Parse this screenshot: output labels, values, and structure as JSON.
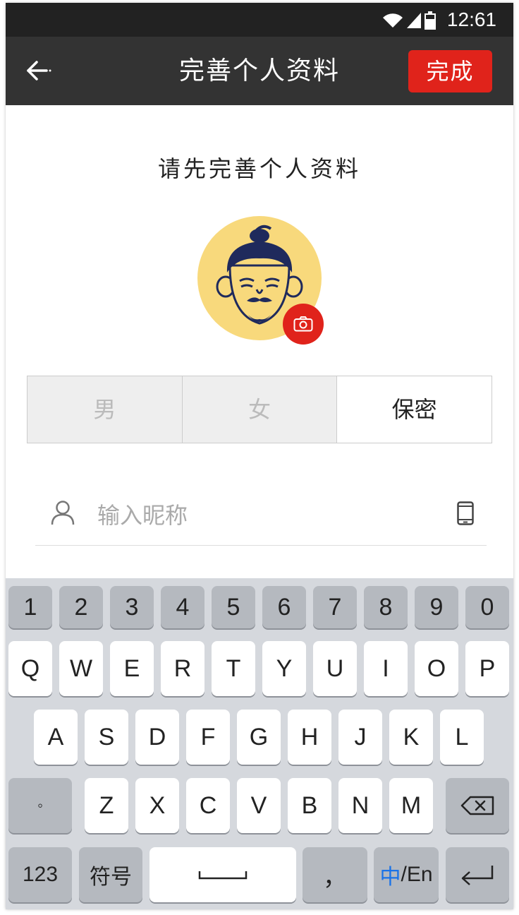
{
  "status": {
    "time": "12:61",
    "icons": [
      "wifi-icon",
      "signal-icon",
      "battery-icon"
    ]
  },
  "nav": {
    "title": "完善个人资料",
    "done_label": "完成"
  },
  "main": {
    "prompt": "请先完善个人资料",
    "gender": {
      "options": [
        "男",
        "女",
        "保密"
      ],
      "selected": "保密"
    },
    "nickname": {
      "placeholder": "输入昵称",
      "value": ""
    }
  },
  "keyboard": {
    "numbers": [
      "1",
      "2",
      "3",
      "4",
      "5",
      "6",
      "7",
      "8",
      "9",
      "0"
    ],
    "row1": [
      "Q",
      "W",
      "E",
      "R",
      "T",
      "Y",
      "U",
      "I",
      "O",
      "P"
    ],
    "row2": [
      "A",
      "S",
      "D",
      "F",
      "G",
      "H",
      "J",
      "K",
      "L"
    ],
    "row3_left": "◦",
    "row3": [
      "Z",
      "X",
      "C",
      "V",
      "B",
      "N",
      "M"
    ],
    "bottom": {
      "num": "123",
      "symbol": "符号",
      "comma": "，",
      "lang_zh": "中",
      "lang_rest": "/En"
    }
  },
  "colors": {
    "accent": "#e0231b",
    "navbar": "#333333",
    "statusbar": "#222222",
    "avatar_bg": "#f8d97c"
  }
}
